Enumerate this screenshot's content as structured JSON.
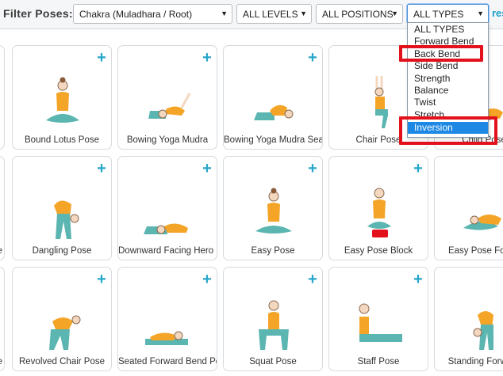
{
  "filter_bar": {
    "label": "Filter Poses:",
    "chakra_value": "Chakra (Muladhara / Root)",
    "levels_value": "ALL LEVELS",
    "positions_value": "ALL POSITIONS",
    "types_value": "ALL TYPES",
    "reset_link": "reset"
  },
  "types_dropdown": {
    "options": [
      "ALL TYPES",
      "Forward Bend",
      "Back Bend",
      "Side Bend",
      "Strength",
      "Balance",
      "Twist",
      "Stretch",
      "Inversion"
    ],
    "active_option": "Inversion"
  },
  "cards": [
    {
      "name": "Bound Lotus Pose"
    },
    {
      "name": "Bowing Yoga Mudra"
    },
    {
      "name": "Bowing Yoga Mudra Seat"
    },
    {
      "name": "Chair Pose"
    },
    {
      "name": "Child Pose"
    },
    {
      "name": "Dangling Pose"
    },
    {
      "name": "Downward Facing Hero P"
    },
    {
      "name": "Easy Pose"
    },
    {
      "name": "Easy Pose Block"
    },
    {
      "name": "Easy Pose Forwa"
    },
    {
      "name": "Revolved Chair Pose"
    },
    {
      "name": "Seated Forward Bend Pos"
    },
    {
      "name": "Squat Pose"
    },
    {
      "name": "Staff Pose"
    },
    {
      "name": "Standing Forward"
    }
  ],
  "left_edge_fragments": [
    "se",
    "se"
  ],
  "icons": {
    "add": "plus-icon",
    "dropdown": "chevron-down-icon"
  },
  "colors": {
    "accent": "#26a6c9",
    "highlight": "#e3111b",
    "selected": "#1e88e5",
    "pose_top": "#f4a528",
    "pose_bottom": "#5bb5b0"
  }
}
